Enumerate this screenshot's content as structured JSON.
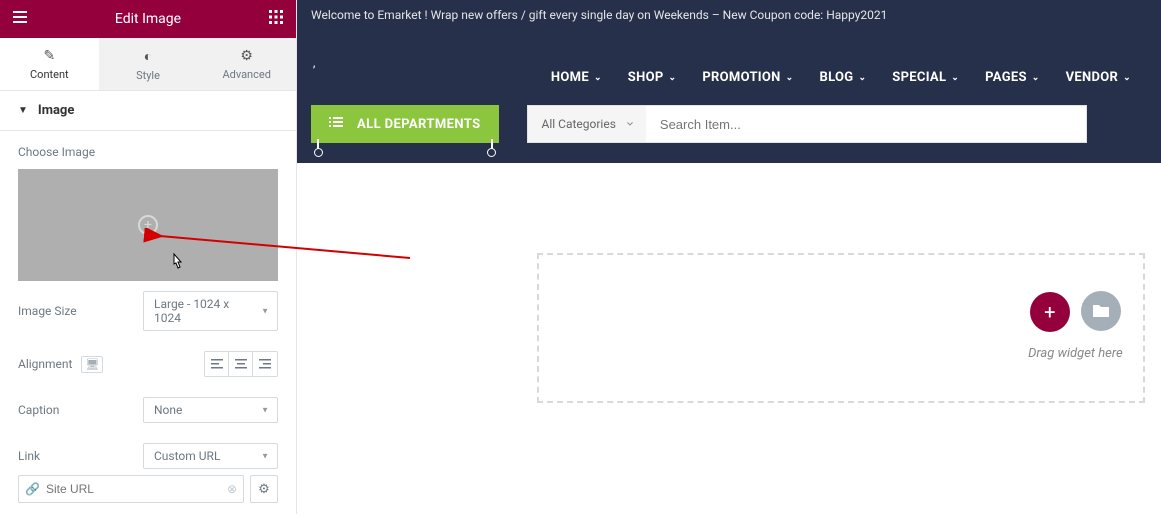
{
  "panel": {
    "title": "Edit Image",
    "tabs": {
      "content": "Content",
      "style": "Style",
      "advanced": "Advanced"
    },
    "section_title": "Image",
    "choose_image": "Choose Image",
    "image_size_label": "Image Size",
    "image_size_value": "Large - 1024 x 1024",
    "alignment_label": "Alignment",
    "caption_label": "Caption",
    "caption_value": "None",
    "link_label": "Link",
    "link_value": "Custom URL",
    "url_placeholder": "Site URL"
  },
  "preview": {
    "announcement": "Welcome to Emarket ! Wrap new offers / gift every single day on Weekends – New Coupon code: Happy2021",
    "comma": ",",
    "nav": {
      "home": "HOME",
      "shop": "SHOP",
      "promotion": "PROMOTION",
      "blog": "BLOG",
      "special": "SPECIAL",
      "pages": "PAGES",
      "vendor": "VENDOR"
    },
    "departments": "ALL DEPARTMENTS",
    "category_select": "All Categories",
    "search_placeholder": "Search Item...",
    "drag_text": "Drag widget here"
  }
}
